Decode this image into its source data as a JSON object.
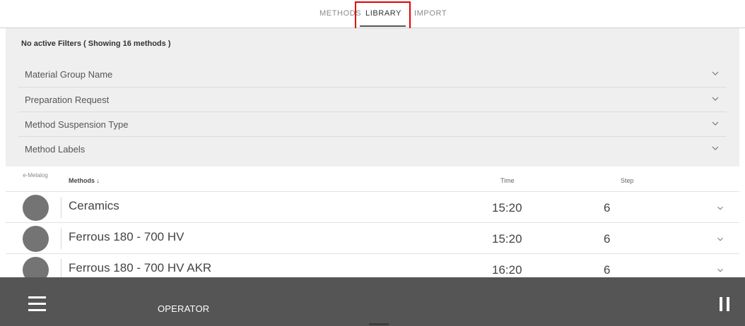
{
  "tabs": [
    {
      "label": "METHODS"
    },
    {
      "label": "LIBRARY"
    },
    {
      "label": "IMPORT"
    }
  ],
  "active_tab": "LIBRARY",
  "filters": {
    "summary": "No active Filters ( Showing 16 methods )",
    "rows": [
      {
        "label": "Material Group Name"
      },
      {
        "label": "Preparation Request"
      },
      {
        "label": "Method Suspension Type"
      },
      {
        "label": "Method Labels"
      }
    ]
  },
  "table": {
    "headers": {
      "emetalog": "e-Metalog",
      "methods": "Methods ↓",
      "time": "Time",
      "step": "Step"
    },
    "rows": [
      {
        "name": "Ceramics",
        "time": "15:20",
        "step": "6"
      },
      {
        "name": "Ferrous 180 - 700 HV",
        "time": "15:20",
        "step": "6"
      },
      {
        "name": "Ferrous 180 - 700 HV AKR",
        "time": "16:20",
        "step": "6"
      }
    ]
  },
  "bottom_bar": {
    "user_label": "OPERATOR",
    "menu_icon": "hamburger-menu-icon",
    "pause_icon": "pause-icon"
  },
  "colors": {
    "highlight": "#e10000",
    "bottom_bar": "#555555",
    "filter_panel": "#efefef",
    "avatar": "#747474"
  }
}
